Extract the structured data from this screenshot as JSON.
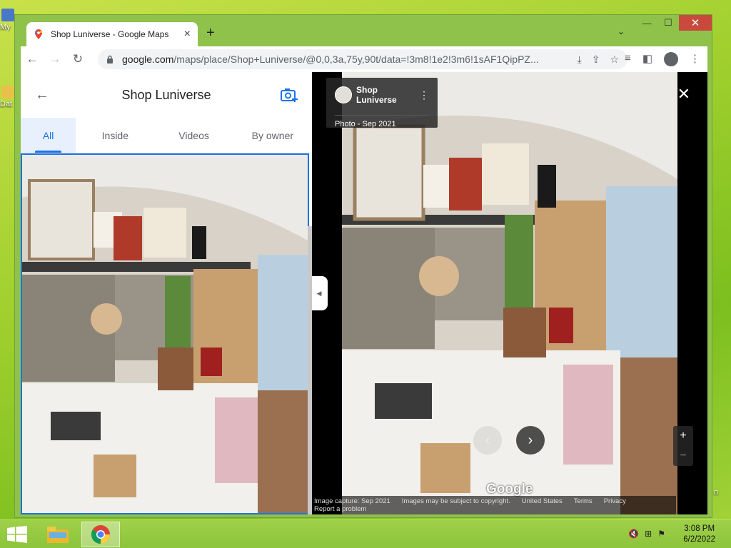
{
  "desktop": {
    "icons": [
      {
        "label": "My",
        "icon": "computer-icon"
      },
      {
        "label": "Dat",
        "icon": "data-folder-icon"
      }
    ],
    "right_edge_label": "n"
  },
  "browser": {
    "tab_title": "Shop Luniverse - Google Maps",
    "url_host": "google.com",
    "url_path": "/maps/place/Shop+Luniverse/@0,0,3a,75y,90t/data=!3m8!1e2!3m6!1sAF1QipPZ...",
    "window_controls": {
      "minimize": "—",
      "maximize": "☐",
      "close": "✕"
    }
  },
  "panel": {
    "back_icon": "arrow-left-icon",
    "place_name": "Shop Luniverse",
    "tabs": [
      {
        "label": "All",
        "active": true
      },
      {
        "label": "Inside",
        "active": false
      },
      {
        "label": "Videos",
        "active": false
      },
      {
        "label": "By owner",
        "active": false
      }
    ]
  },
  "viewer": {
    "owner_name": "Shop Luniverse",
    "photo_date": "Photo - Sep 2021",
    "brand": "Google",
    "attribution": {
      "capture": "Image capture: Sep 2021",
      "copyright": "Images may be subject to copyright.",
      "country": "United States",
      "terms": "Terms",
      "privacy": "Privacy",
      "report": "Report a problem"
    },
    "zoom_in": "+",
    "zoom_out": "−"
  },
  "taskbar": {
    "time": "3:08 PM",
    "date": "6/2/2022"
  },
  "colors": {
    "accent": "#1a73e8",
    "window_frame": "#8fc24a",
    "close_button": "#c94a3c"
  }
}
